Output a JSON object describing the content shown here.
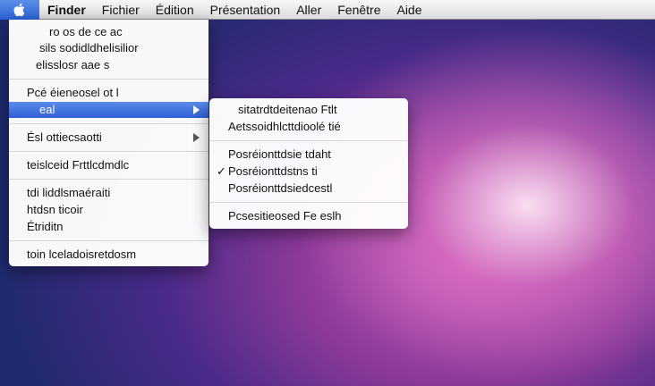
{
  "menubar": {
    "items": [
      "Finder",
      "Fichier",
      "Édition",
      "Présentation",
      "Aller",
      "Fenêtre",
      "Aide"
    ]
  },
  "menu": {
    "group1": [
      "ro os de ce ac",
      "sils sodidldhelisilior",
      "elisslosr aae s"
    ],
    "group2": {
      "item1": "Pcé éieneosel ot l",
      "highlighted": "eal"
    },
    "group3": "Ésl ottiecsaotti",
    "group4": "teislceid Frttlcdmdlc",
    "group5": [
      "tdi liddlsmaéraiti",
      "htdsn ticoir",
      "Étriditn"
    ],
    "group6": "toin lceladoisretdosm"
  },
  "submenu": {
    "group1": [
      "sitatrdtdeitenao Ftlt",
      "Aetssoidhlcttdioolé tié"
    ],
    "group2": [
      "Posréionttdsie tdaht",
      "Posréionttdstns ti",
      "Posréionttdsiedcestl"
    ],
    "checked_index": 1,
    "group3": "Pcsesitieosed Fe eslh"
  },
  "colors": {
    "highlight": "#3f6fde"
  },
  "icons": {
    "apple": "apple-icon",
    "check": "checkmark-icon",
    "arrow": "submenu-arrow-icon"
  }
}
